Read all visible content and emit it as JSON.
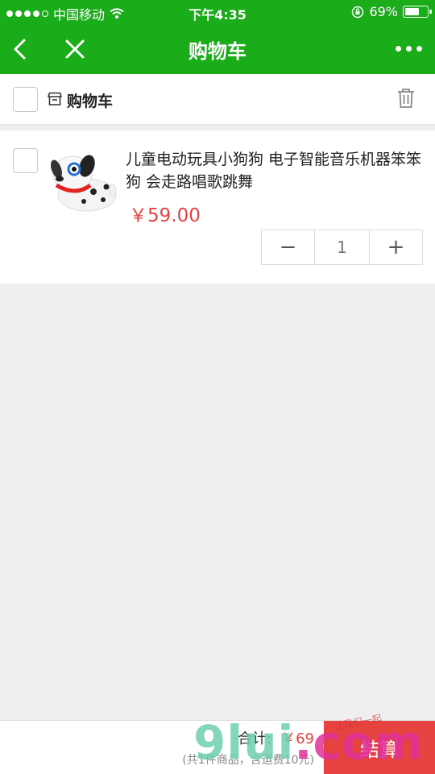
{
  "status": {
    "carrier": "中国移动",
    "time": "下午4:35",
    "battery": "69%",
    "battery_level": 0.69
  },
  "nav": {
    "title": "购物车"
  },
  "shop": {
    "title": "购物车"
  },
  "item": {
    "title": "儿童电动玩具小狗狗 电子智能音乐机器笨笨狗 会走路唱歌跳舞",
    "price": "￥59.00",
    "quantity": "1",
    "minus": "−",
    "plus": "+"
  },
  "footer": {
    "total_label": "合计:",
    "total_amount": "￥69",
    "note": "(共1件商品，含运费10元)",
    "checkout_label": "结算"
  },
  "watermark": {
    "part1": "9lui",
    "part2": ".com",
    "small": "让我们一起"
  },
  "colors": {
    "brand": "#1aad19",
    "price": "#e64340",
    "checkout": "#e64340"
  }
}
